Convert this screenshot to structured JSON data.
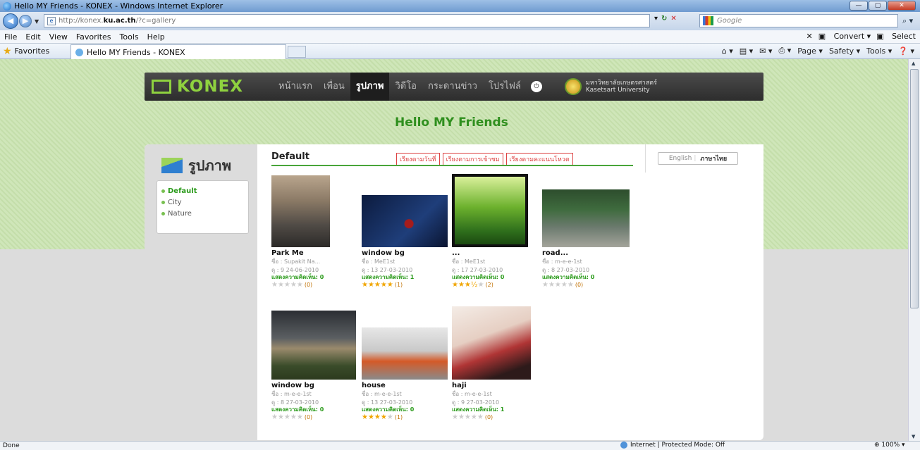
{
  "window": {
    "title": "Hello MY Friends - KONEX - Windows Internet Explorer",
    "btn_min": "—",
    "btn_max": "▢",
    "btn_close": "✕"
  },
  "address": {
    "prefix": "http://konex.",
    "domain": "ku.ac.th",
    "suffix": "/?c=gallery",
    "search_placeholder": "Google"
  },
  "menu": {
    "items": [
      "File",
      "Edit",
      "View",
      "Favorites",
      "Tools",
      "Help"
    ],
    "convert": "Convert",
    "select": "Select"
  },
  "favorites": {
    "label": "Favorites",
    "tab_title": "Hello MY Friends - KONEX"
  },
  "commandbar": {
    "page": "Page ▾",
    "safety": "Safety ▾",
    "tools": "Tools ▾"
  },
  "site": {
    "logo": "KONEX",
    "nav": [
      "หน้าแรก",
      "เพื่อน",
      "รูปภาพ",
      "วิดีโอ",
      "กระดานข่าว",
      "โปรไฟล์"
    ],
    "active_nav": 2,
    "university_th": "มหาวิทยาลัยเกษตรศาสตร์",
    "university_en": "Kasetsart University",
    "page_title": "Hello MY Friends"
  },
  "sidebar": {
    "title": "รูปภาพ",
    "albums": [
      "Default",
      "City",
      "Nature"
    ],
    "active_album": 0
  },
  "gallery": {
    "album": "Default",
    "sort_buttons": [
      "เรียงตามวันที่",
      "เรียงตามการเข้าชม",
      "เรียงตามคะแนนโหวต"
    ],
    "lang_en": "English",
    "lang_th": "ภาษาไทย",
    "items": [
      {
        "name": "Park Me",
        "owner": "ชื่อ : Supakit Na...",
        "info": "ดู : 9 24-06-2010",
        "comments": "แสดงความคิดเห็น: 0",
        "rating": 0,
        "votes": "(0)"
      },
      {
        "name": "window bg",
        "owner": "ชื่อ : MeE1st",
        "info": "ดู : 13 27-03-2010",
        "comments": "แสดงความคิดเห็น: 1",
        "rating": 5,
        "votes": "(1)"
      },
      {
        "name": "...",
        "owner": "ชื่อ : MeE1st",
        "info": "ดู : 17 27-03-2010",
        "comments": "แสดงความคิดเห็น: 0",
        "rating": 3.5,
        "votes": "(2)"
      },
      {
        "name": "road...",
        "owner": "ชื่อ : m-e-e-1st",
        "info": "ดู : 8 27-03-2010",
        "comments": "แสดงความคิดเห็น: 0",
        "rating": 0,
        "votes": "(0)"
      },
      {
        "name": "window bg",
        "owner": "ชื่อ : m-e-e-1st",
        "info": "ดู : 8 27-03-2010",
        "comments": "แสดงความคิดเห็น: 0",
        "rating": 0,
        "votes": "(0)"
      },
      {
        "name": "house",
        "owner": "ชื่อ : m-e-e-1st",
        "info": "ดู : 13 27-03-2010",
        "comments": "แสดงความคิดเห็น: 0",
        "rating": 4,
        "votes": "(1)"
      },
      {
        "name": "haji",
        "owner": "ชื่อ : m-e-e-1st",
        "info": "ดู : 9 27-03-2010",
        "comments": "แสดงความคิดเห็น: 1",
        "rating": 0,
        "votes": "(0)"
      }
    ]
  },
  "status": {
    "left": "Done",
    "zone": "Internet | Protected Mode: Off",
    "zoom": "100%"
  }
}
